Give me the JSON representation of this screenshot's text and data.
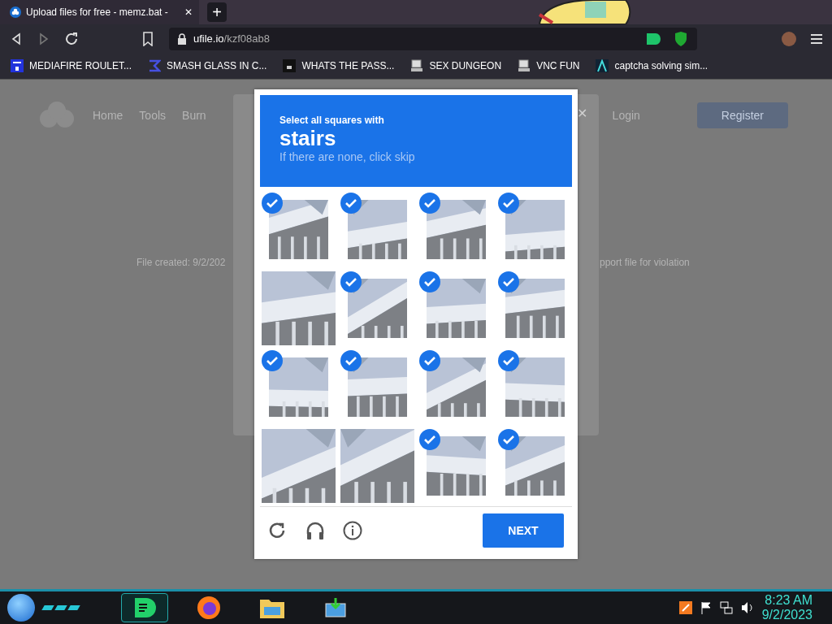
{
  "browser": {
    "tab": {
      "title": "Upload files for free - memz.bat - ",
      "close": "✕"
    },
    "new_tab": "+",
    "address": {
      "host": "ufile.io",
      "path": "/kzf08ab8"
    },
    "bookmarks": [
      {
        "label": "MEDIAFIRE ROULET..."
      },
      {
        "label": "SMASH GLASS IN C..."
      },
      {
        "label": "WHATS THE PASS..."
      },
      {
        "label": "SEX DUNGEON"
      },
      {
        "label": "VNC FUN"
      },
      {
        "label": "captcha solving sim..."
      }
    ]
  },
  "page": {
    "nav": [
      "Home",
      "Tools",
      "Burn"
    ],
    "login": "Login",
    "register": "Register",
    "created": "File created: 9/2/202",
    "report": "pport file for violation",
    "close": "✕"
  },
  "captcha": {
    "prompt": "Select all squares with",
    "target": "stairs",
    "hint": "If there are none, click skip",
    "tiles": [
      {
        "selected": true
      },
      {
        "selected": true
      },
      {
        "selected": true
      },
      {
        "selected": true
      },
      {
        "selected": false
      },
      {
        "selected": true
      },
      {
        "selected": true
      },
      {
        "selected": true
      },
      {
        "selected": true
      },
      {
        "selected": true
      },
      {
        "selected": true
      },
      {
        "selected": true
      },
      {
        "selected": false
      },
      {
        "selected": false
      },
      {
        "selected": true
      },
      {
        "selected": true
      }
    ],
    "button": "NEXT"
  },
  "taskbar": {
    "time": "8:23 AM",
    "date": "9/2/2023"
  }
}
